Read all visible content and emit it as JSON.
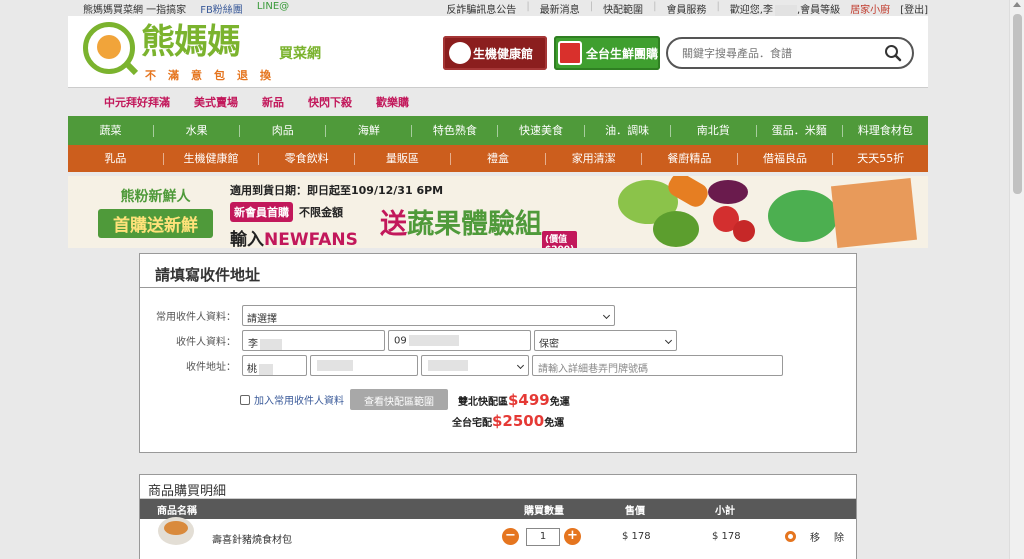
{
  "topbar": {
    "brand": "熊媽媽買菜網 一指搞家",
    "fb": "FB粉絲團",
    "line": "LINE@",
    "links": [
      "反詐騙訊息公告",
      "最新消息",
      "快配範圍",
      "會員服務"
    ],
    "welcome": "歡迎您,李",
    "member_level": ",會員等級",
    "level_name": "居家小廚",
    "logout": "[登出]"
  },
  "logo": {
    "name": "熊媽媽",
    "sub": "買菜網",
    "slogan": "不滿意包退換"
  },
  "header": {
    "mobile_btn": "生機健康館",
    "group_btn": "全台生鮮團購",
    "search_placeholder": "關鍵字搜尋產品．食譜"
  },
  "promo_nav": [
    "中元拜好拜滿",
    "美式賣場",
    "新品",
    "快閃下殺",
    "歡樂購"
  ],
  "nav_green": [
    "蔬菜",
    "水果",
    "肉品",
    "海鮮",
    "特色熟食",
    "快速美食",
    "油．調味",
    "南北貨",
    "蛋品．米麵",
    "料理食材包"
  ],
  "nav_orange": [
    "乳品",
    "生機健康館",
    "零食飲料",
    "量販區",
    "禮盒",
    "家用清潔",
    "餐廚精品",
    "借福良品",
    "天天55折"
  ],
  "banner": {
    "left1": "熊粉新鮮人",
    "left2": "首購送新鮮",
    "date": "適用到貨日期：即日起至109/12/31 6PM",
    "pill": "新會員首購",
    "nolimit": "不限金額",
    "code_prefix": "輸入",
    "code": "NEWFANS",
    "big1": "送",
    "big2": "蔬果體驗組",
    "price": "(價值$200)"
  },
  "form": {
    "title": "請填寫收件地址",
    "common_label": "常用收件人資料：",
    "common_value": "請選擇",
    "recipient_label": "收件人資料：",
    "name_value": "李",
    "phone_value": "09",
    "privacy_value": "保密",
    "address_label": "收件地址：",
    "city_value": "桃",
    "address_placeholder": "請輸入詳細巷弄門牌號碼",
    "add_common": "加入常用收件人資料",
    "check_range": "查看快配區範圍",
    "ship1_prefix": "雙北快配區",
    "ship1_amount": "$499",
    "ship1_suffix": "免運",
    "ship2_prefix": "全台宅配",
    "ship2_amount": "$2500",
    "ship2_suffix": "免運"
  },
  "cart": {
    "title": "商品購買明細",
    "headers": [
      "商品名稱",
      "購買數量",
      "售價",
      "小計"
    ],
    "item": {
      "name": "壽喜針豬燒食材包",
      "qty": "1",
      "price": "$ 178",
      "subtotal": "$ 178",
      "remove1": "移",
      "remove2": "除"
    }
  },
  "colors": {
    "green": "#4f9a3a",
    "orange": "#cc5e1d",
    "magenta": "#c2185b",
    "accent": "#e5751f"
  }
}
